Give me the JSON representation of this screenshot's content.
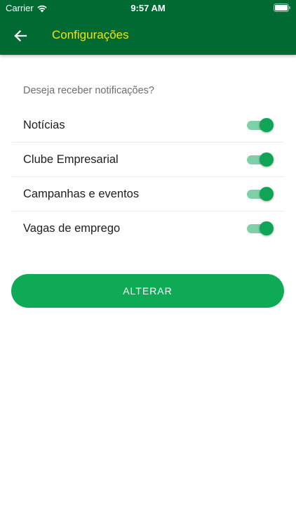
{
  "status_bar": {
    "carrier": "Carrier",
    "time": "9:57 AM",
    "wifi_icon": "wifi-icon",
    "battery_icon": "battery-icon"
  },
  "app_bar": {
    "back_icon": "arrow-left-icon",
    "title": "Configurações",
    "background_color": "#006a33",
    "title_color": "#f2e21c"
  },
  "notifications": {
    "prompt": "Deseja receber notificações?",
    "options": [
      {
        "label": "Notícias",
        "enabled": true
      },
      {
        "label": "Clube Empresarial",
        "enabled": true
      },
      {
        "label": "Campanhas e eventos",
        "enabled": true
      },
      {
        "label": "Vagas de emprego",
        "enabled": true
      }
    ],
    "toggle_on_color": "#0fa456"
  },
  "actions": {
    "submit_label": "ALTERAR",
    "button_color": "#0faa55"
  }
}
